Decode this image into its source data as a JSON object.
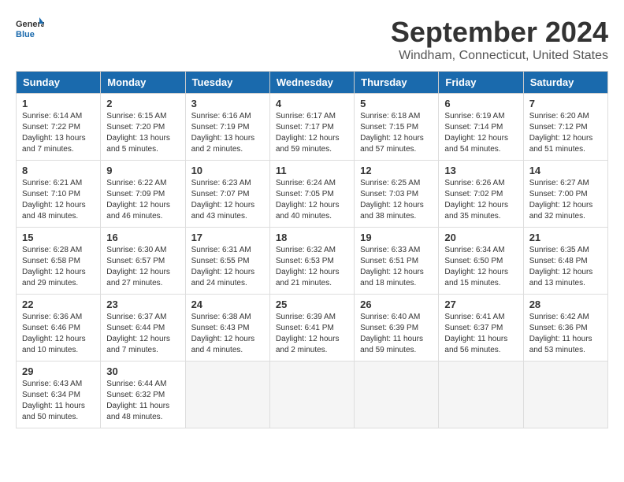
{
  "logo": {
    "line1": "General",
    "line2": "Blue"
  },
  "title": "September 2024",
  "location": "Windham, Connecticut, United States",
  "headers": [
    "Sunday",
    "Monday",
    "Tuesday",
    "Wednesday",
    "Thursday",
    "Friday",
    "Saturday"
  ],
  "weeks": [
    [
      {
        "num": "1",
        "info": "Sunrise: 6:14 AM\nSunset: 7:22 PM\nDaylight: 13 hours\nand 7 minutes."
      },
      {
        "num": "2",
        "info": "Sunrise: 6:15 AM\nSunset: 7:20 PM\nDaylight: 13 hours\nand 5 minutes."
      },
      {
        "num": "3",
        "info": "Sunrise: 6:16 AM\nSunset: 7:19 PM\nDaylight: 13 hours\nand 2 minutes."
      },
      {
        "num": "4",
        "info": "Sunrise: 6:17 AM\nSunset: 7:17 PM\nDaylight: 12 hours\nand 59 minutes."
      },
      {
        "num": "5",
        "info": "Sunrise: 6:18 AM\nSunset: 7:15 PM\nDaylight: 12 hours\nand 57 minutes."
      },
      {
        "num": "6",
        "info": "Sunrise: 6:19 AM\nSunset: 7:14 PM\nDaylight: 12 hours\nand 54 minutes."
      },
      {
        "num": "7",
        "info": "Sunrise: 6:20 AM\nSunset: 7:12 PM\nDaylight: 12 hours\nand 51 minutes."
      }
    ],
    [
      {
        "num": "8",
        "info": "Sunrise: 6:21 AM\nSunset: 7:10 PM\nDaylight: 12 hours\nand 48 minutes."
      },
      {
        "num": "9",
        "info": "Sunrise: 6:22 AM\nSunset: 7:09 PM\nDaylight: 12 hours\nand 46 minutes."
      },
      {
        "num": "10",
        "info": "Sunrise: 6:23 AM\nSunset: 7:07 PM\nDaylight: 12 hours\nand 43 minutes."
      },
      {
        "num": "11",
        "info": "Sunrise: 6:24 AM\nSunset: 7:05 PM\nDaylight: 12 hours\nand 40 minutes."
      },
      {
        "num": "12",
        "info": "Sunrise: 6:25 AM\nSunset: 7:03 PM\nDaylight: 12 hours\nand 38 minutes."
      },
      {
        "num": "13",
        "info": "Sunrise: 6:26 AM\nSunset: 7:02 PM\nDaylight: 12 hours\nand 35 minutes."
      },
      {
        "num": "14",
        "info": "Sunrise: 6:27 AM\nSunset: 7:00 PM\nDaylight: 12 hours\nand 32 minutes."
      }
    ],
    [
      {
        "num": "15",
        "info": "Sunrise: 6:28 AM\nSunset: 6:58 PM\nDaylight: 12 hours\nand 29 minutes."
      },
      {
        "num": "16",
        "info": "Sunrise: 6:30 AM\nSunset: 6:57 PM\nDaylight: 12 hours\nand 27 minutes."
      },
      {
        "num": "17",
        "info": "Sunrise: 6:31 AM\nSunset: 6:55 PM\nDaylight: 12 hours\nand 24 minutes."
      },
      {
        "num": "18",
        "info": "Sunrise: 6:32 AM\nSunset: 6:53 PM\nDaylight: 12 hours\nand 21 minutes."
      },
      {
        "num": "19",
        "info": "Sunrise: 6:33 AM\nSunset: 6:51 PM\nDaylight: 12 hours\nand 18 minutes."
      },
      {
        "num": "20",
        "info": "Sunrise: 6:34 AM\nSunset: 6:50 PM\nDaylight: 12 hours\nand 15 minutes."
      },
      {
        "num": "21",
        "info": "Sunrise: 6:35 AM\nSunset: 6:48 PM\nDaylight: 12 hours\nand 13 minutes."
      }
    ],
    [
      {
        "num": "22",
        "info": "Sunrise: 6:36 AM\nSunset: 6:46 PM\nDaylight: 12 hours\nand 10 minutes."
      },
      {
        "num": "23",
        "info": "Sunrise: 6:37 AM\nSunset: 6:44 PM\nDaylight: 12 hours\nand 7 minutes."
      },
      {
        "num": "24",
        "info": "Sunrise: 6:38 AM\nSunset: 6:43 PM\nDaylight: 12 hours\nand 4 minutes."
      },
      {
        "num": "25",
        "info": "Sunrise: 6:39 AM\nSunset: 6:41 PM\nDaylight: 12 hours\nand 2 minutes."
      },
      {
        "num": "26",
        "info": "Sunrise: 6:40 AM\nSunset: 6:39 PM\nDaylight: 11 hours\nand 59 minutes."
      },
      {
        "num": "27",
        "info": "Sunrise: 6:41 AM\nSunset: 6:37 PM\nDaylight: 11 hours\nand 56 minutes."
      },
      {
        "num": "28",
        "info": "Sunrise: 6:42 AM\nSunset: 6:36 PM\nDaylight: 11 hours\nand 53 minutes."
      }
    ],
    [
      {
        "num": "29",
        "info": "Sunrise: 6:43 AM\nSunset: 6:34 PM\nDaylight: 11 hours\nand 50 minutes."
      },
      {
        "num": "30",
        "info": "Sunrise: 6:44 AM\nSunset: 6:32 PM\nDaylight: 11 hours\nand 48 minutes."
      },
      null,
      null,
      null,
      null,
      null
    ]
  ]
}
